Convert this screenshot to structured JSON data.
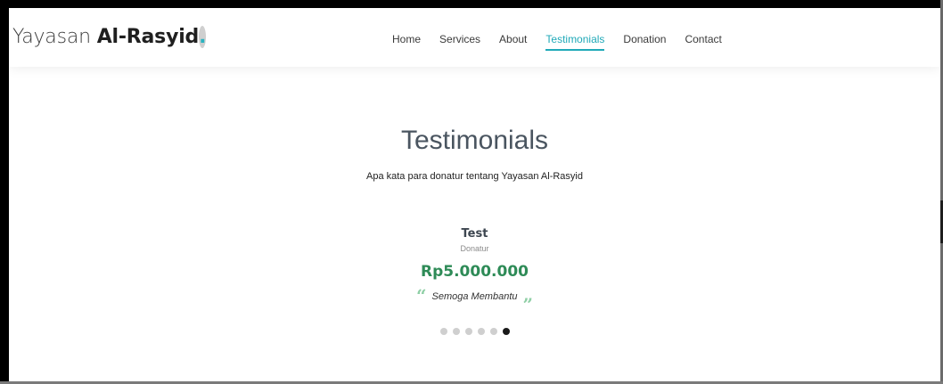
{
  "logo": {
    "light": "Yayasan",
    "bold": "Al-Rasyid",
    "dot": "."
  },
  "nav": [
    {
      "label": "Home",
      "active": false
    },
    {
      "label": "Services",
      "active": false
    },
    {
      "label": "About",
      "active": false
    },
    {
      "label": "Testimonials",
      "active": true
    },
    {
      "label": "Donation",
      "active": false
    },
    {
      "label": "Contact",
      "active": false
    }
  ],
  "section": {
    "title": "Testimonials",
    "subtitle": "Apa kata para donatur tentang Yayasan Al-Rasyid"
  },
  "testimonial": {
    "name": "Test",
    "role": "Donatur",
    "amount": "Rp5.000.000",
    "quote": "Semoga Membantu",
    "open_mark": "“",
    "close_mark": "”"
  },
  "carousel": {
    "total": 6,
    "active_index": 5
  },
  "colors": {
    "accent": "#20a9b8",
    "amount": "#2e8b57",
    "quote_mark": "#8fcfa6",
    "dot_inactive": "#cfcfcf",
    "dot_active": "#1a1a1a"
  }
}
